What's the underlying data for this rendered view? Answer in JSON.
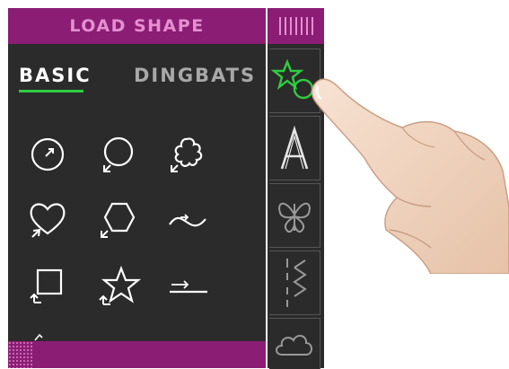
{
  "panel": {
    "title": "LOAD SHAPE",
    "tabs": [
      {
        "label": "BASIC",
        "active": true
      },
      {
        "label": "DINGBATS",
        "active": false
      }
    ],
    "shapes": [
      {
        "icon": "circle-shape-icon"
      },
      {
        "icon": "oval-shape-icon"
      },
      {
        "icon": "flower-shape-icon"
      },
      {
        "icon": "heart-shape-icon"
      },
      {
        "icon": "hexagon-shape-icon"
      },
      {
        "icon": "wave-line-icon"
      },
      {
        "icon": "square-shape-icon"
      },
      {
        "icon": "star-shape-icon"
      },
      {
        "icon": "straight-line-icon"
      }
    ]
  },
  "strip": {
    "items": [
      {
        "icon": "star-circle-icon",
        "selected": true
      },
      {
        "icon": "letter-a-icon",
        "glyph": "A"
      },
      {
        "icon": "butterfly-icon"
      },
      {
        "icon": "zigzag-stitch-icon"
      },
      {
        "icon": "cloud-icon"
      }
    ]
  },
  "colors": {
    "header": "#8b1d74",
    "header_text": "#e48fd1",
    "panel_bg": "#2b2b2b",
    "accent": "#2ecc40"
  }
}
